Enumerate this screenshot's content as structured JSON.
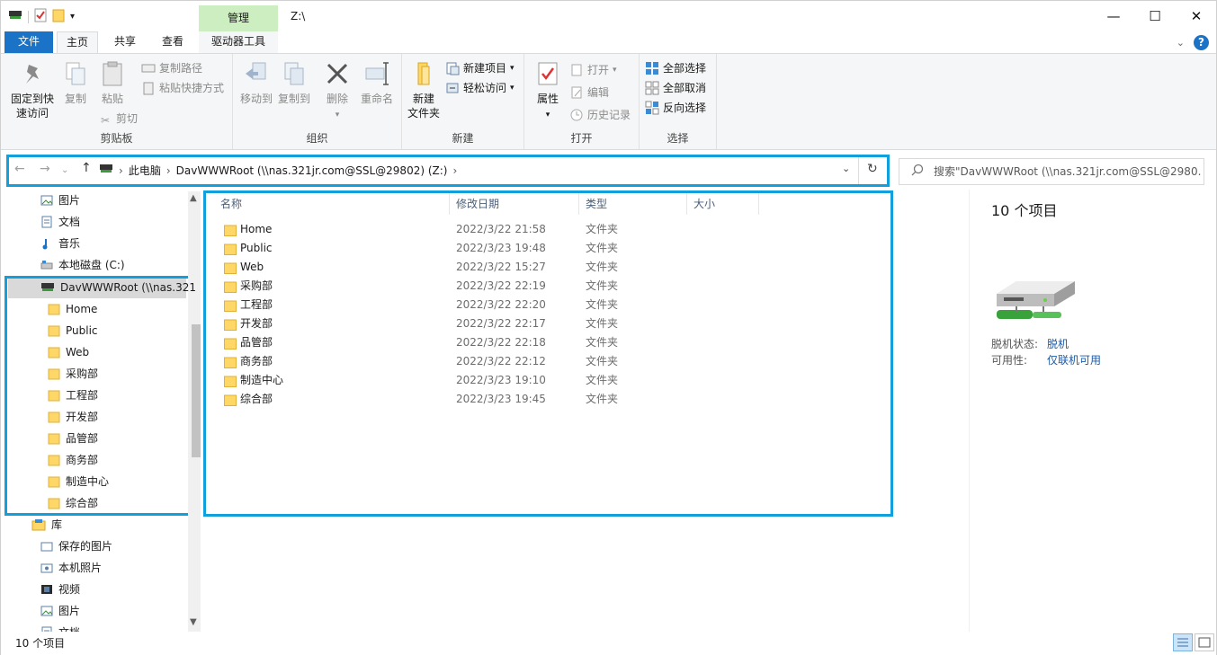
{
  "window": {
    "title": "Z:\\",
    "contextual_tab_group": "管理",
    "minimize": "—",
    "maximize": "☐",
    "close": "✕"
  },
  "tabs": {
    "file": "文件",
    "home": "主页",
    "share": "共享",
    "view": "查看",
    "drive_tools": "驱动器工具"
  },
  "ribbon": {
    "clipboard": {
      "label": "剪贴板",
      "pin_line1": "固定到快",
      "pin_line2": "速访问",
      "copy": "复制",
      "paste": "粘贴",
      "copy_path": "复制路径",
      "paste_shortcut": "粘贴快捷方式",
      "cut": "剪切"
    },
    "organize": {
      "label": "组织",
      "move_to": "移动到",
      "copy_to": "复制到",
      "delete": "删除",
      "rename": "重命名"
    },
    "new": {
      "label": "新建",
      "new_folder_line1": "新建",
      "new_folder_line2": "文件夹",
      "new_item": "新建项目",
      "easy_access": "轻松访问"
    },
    "open": {
      "label": "打开",
      "properties": "属性",
      "open": "打开",
      "edit": "编辑",
      "history": "历史记录"
    },
    "select": {
      "label": "选择",
      "select_all": "全部选择",
      "select_none": "全部取消",
      "invert": "反向选择"
    }
  },
  "address": {
    "crumbs": [
      "此电脑",
      "DavWWWRoot (\\\\nas.321jr.com@SSL@29802) (Z:)"
    ],
    "search_placeholder": "搜索\"DavWWWRoot (\\\\nas.321jr.com@SSL@2980..."
  },
  "nav": {
    "top_items": [
      {
        "label": "图片",
        "icon": "pictures-icon"
      },
      {
        "label": "文档",
        "icon": "documents-icon"
      },
      {
        "label": "音乐",
        "icon": "music-icon"
      },
      {
        "label": "本地磁盘 (C:)",
        "icon": "disk-icon"
      }
    ],
    "selected": "DavWWWRoot (\\\\nas.321",
    "folders": [
      "Home",
      "Public",
      "Web",
      "采购部",
      "工程部",
      "开发部",
      "品管部",
      "商务部",
      "制造中心",
      "综合部"
    ],
    "library": "库",
    "library_items": [
      {
        "label": "保存的图片",
        "icon": "saved-pictures-icon"
      },
      {
        "label": "本机照片",
        "icon": "camera-roll-icon"
      },
      {
        "label": "视频",
        "icon": "videos-icon"
      },
      {
        "label": "图片",
        "icon": "pictures-icon"
      },
      {
        "label": "文档",
        "icon": "documents-icon"
      }
    ]
  },
  "columns": {
    "name": "名称",
    "modified": "修改日期",
    "type": "类型",
    "size": "大小"
  },
  "files": [
    {
      "name": "Home",
      "date": "2022/3/22 21:58",
      "type": "文件夹"
    },
    {
      "name": "Public",
      "date": "2022/3/23 19:48",
      "type": "文件夹"
    },
    {
      "name": "Web",
      "date": "2022/3/22 15:27",
      "type": "文件夹"
    },
    {
      "name": "采购部",
      "date": "2022/3/22 22:19",
      "type": "文件夹"
    },
    {
      "name": "工程部",
      "date": "2022/3/22 22:20",
      "type": "文件夹"
    },
    {
      "name": "开发部",
      "date": "2022/3/22 22:17",
      "type": "文件夹"
    },
    {
      "name": "品管部",
      "date": "2022/3/22 22:18",
      "type": "文件夹"
    },
    {
      "name": "商务部",
      "date": "2022/3/22 22:12",
      "type": "文件夹"
    },
    {
      "name": "制造中心",
      "date": "2022/3/23 19:10",
      "type": "文件夹"
    },
    {
      "name": "综合部",
      "date": "2022/3/23 19:45",
      "type": "文件夹"
    }
  ],
  "details": {
    "count": "10 个项目",
    "offline_status_key": "脱机状态:",
    "offline_status_val": "脱机",
    "availability_key": "可用性:",
    "availability_val": "仅联机可用"
  },
  "status": {
    "count": "10 个项目"
  },
  "colors": {
    "accent": "#1a73c6",
    "highlight_box": "#11a0dc",
    "folder": "#ffd766",
    "manage_tab": "#cdeec0"
  }
}
